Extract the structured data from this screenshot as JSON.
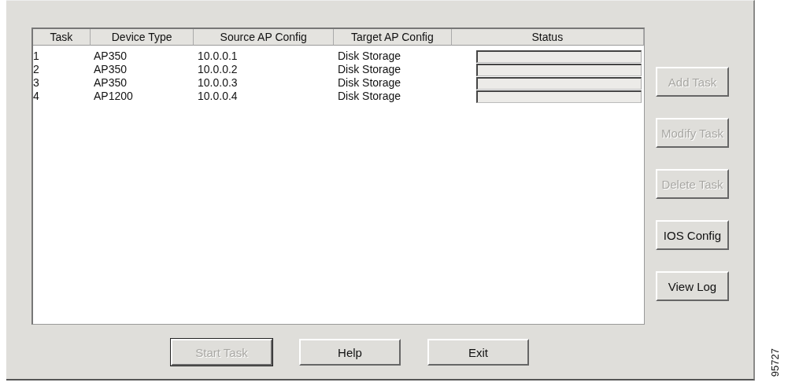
{
  "table": {
    "columns": [
      "Task",
      "Device Type",
      "Source AP Config",
      "Target AP Config",
      "Status"
    ],
    "rows": [
      {
        "task": "1",
        "device_type": "AP350",
        "source": "10.0.0.1",
        "target": "Disk Storage",
        "level": 0
      },
      {
        "task": "2",
        "device_type": "AP350",
        "source": "10.0.0.2",
        "target": "Disk Storage",
        "level": 0
      },
      {
        "task": "3",
        "device_type": "AP350",
        "source": "10.0.0.3",
        "target": "Disk Storage",
        "level": 0
      },
      {
        "task": "4",
        "device_type": "AP1200",
        "source": "10.0.0.4",
        "target": "Disk Storage",
        "level": 0
      }
    ]
  },
  "side_buttons": [
    {
      "label": "Add Task",
      "disabled": true
    },
    {
      "label": "Modify Task",
      "disabled": true
    },
    {
      "label": "Delete Task",
      "disabled": true
    },
    {
      "label": "IOS Config",
      "disabled": false
    },
    {
      "label": "View Log",
      "disabled": false
    }
  ],
  "bottom_buttons": [
    {
      "label": "Start Task",
      "disabled": true,
      "default": true
    },
    {
      "label": "Help",
      "disabled": false,
      "default": false
    },
    {
      "label": "Exit",
      "disabled": false,
      "default": false
    }
  ],
  "figure_number": "95727"
}
